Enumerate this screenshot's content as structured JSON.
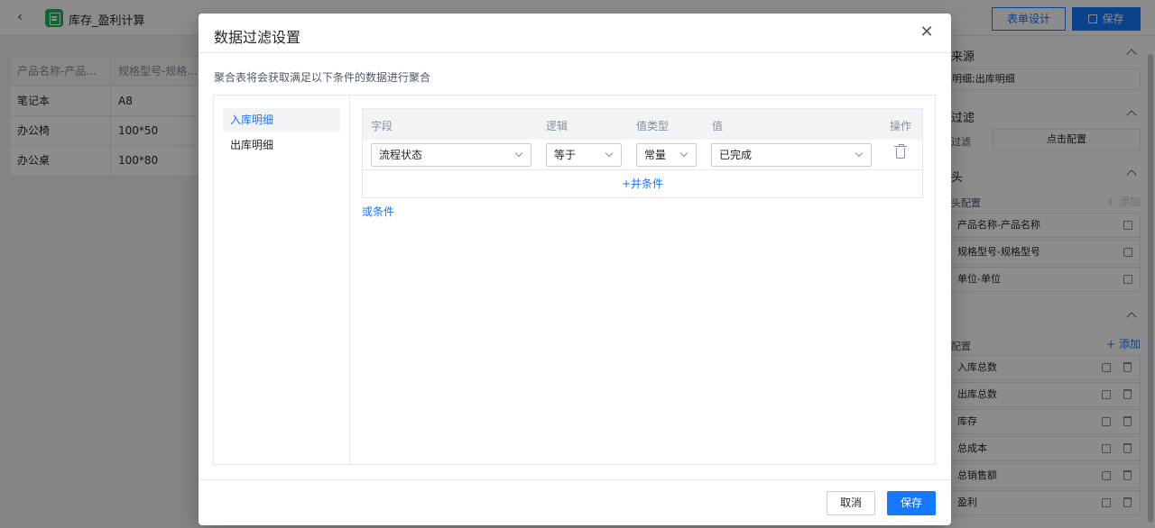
{
  "app": {
    "title": "库存_盈利计算",
    "design_button": "表单设计",
    "save_button": "保存"
  },
  "grid": {
    "headers": [
      "产品名称-产品...",
      "规格型号-规格..."
    ],
    "rows": [
      [
        "笔记本",
        "A8"
      ],
      [
        "办公椅",
        "100*50"
      ],
      [
        "办公桌",
        "100*80"
      ]
    ]
  },
  "right_panel": {
    "source_title": "来源",
    "source_value": "明细;出库明细",
    "filter_title": "过滤",
    "filter_label": "过滤",
    "filter_button": "点击配置",
    "header_title": "头",
    "header_config_label": "头配置",
    "header_add": "+ 添加",
    "header_items": [
      "产品名称-产品名称",
      "规格型号-规格型号",
      "单位-单位"
    ],
    "value_config_label": "配置",
    "value_add": "+ 添加",
    "value_items": [
      "入库总数",
      "出库总数",
      "库存",
      "总成本",
      "总销售额",
      "盈利"
    ]
  },
  "dialog": {
    "title": "数据过滤设置",
    "description": "聚合表将会获取满足以下条件的数据进行聚合",
    "tabs": [
      "入库明细",
      "出库明细"
    ],
    "columns": {
      "field": "字段",
      "logic": "逻辑",
      "value_type": "值类型",
      "value": "值",
      "action": "操作"
    },
    "condition": {
      "field": "流程状态",
      "logic": "等于",
      "value_type": "常量",
      "value": "已完成"
    },
    "and_condition": "+并条件",
    "or_condition": "或条件",
    "cancel": "取消",
    "save": "保存"
  },
  "colors": {
    "primary": "#1677ff",
    "app_icon": "#1fb45a"
  }
}
